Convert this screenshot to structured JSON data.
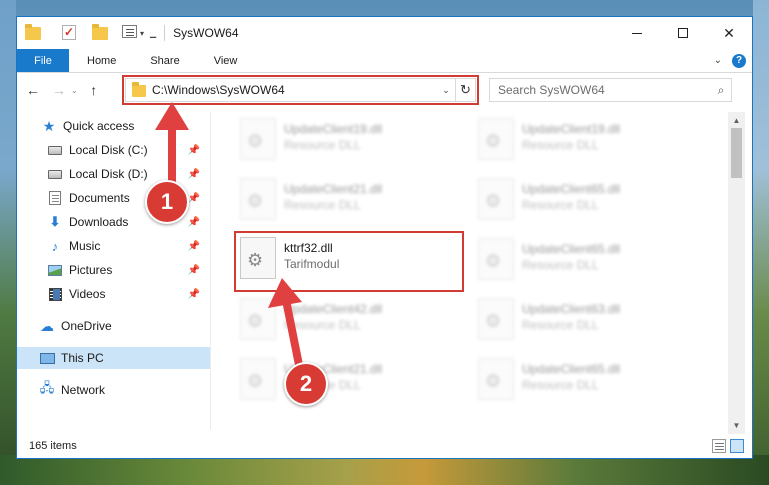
{
  "window": {
    "title": "SysWOW64"
  },
  "ribbon": {
    "tabs": [
      "File",
      "Home",
      "Share",
      "View"
    ]
  },
  "nav": {
    "address": "C:\\Windows\\SysWOW64",
    "search_placeholder": "Search SysWOW64"
  },
  "sidebar": {
    "items": [
      {
        "label": "Quick access",
        "icon": "star-icon"
      },
      {
        "label": "Local Disk (C:)",
        "icon": "drive-icon",
        "pinned": true
      },
      {
        "label": "Local Disk (D:)",
        "icon": "drive-icon",
        "pinned": true
      },
      {
        "label": "Documents",
        "icon": "document-icon",
        "pinned": true
      },
      {
        "label": "Downloads",
        "icon": "download-icon",
        "pinned": true
      },
      {
        "label": "Music",
        "icon": "music-icon",
        "pinned": true
      },
      {
        "label": "Pictures",
        "icon": "picture-icon",
        "pinned": true
      },
      {
        "label": "Videos",
        "icon": "video-icon",
        "pinned": true
      },
      {
        "label": "OneDrive",
        "icon": "cloud-icon"
      },
      {
        "label": "This PC",
        "icon": "computer-icon",
        "selected": true
      },
      {
        "label": "Network",
        "icon": "network-icon"
      }
    ]
  },
  "files": [
    {
      "name": "UpdateClient19.dll",
      "type": "Resource DLL",
      "blurred": true
    },
    {
      "name": "UpdateClient19.dll",
      "type": "Resource DLL",
      "blurred": true
    },
    {
      "name": "UpdateClient21.dll",
      "type": "Resource DLL",
      "blurred": true
    },
    {
      "name": "UpdateClient65.dll",
      "type": "Resource DLL",
      "blurred": true
    },
    {
      "name": "kttrf32.dll",
      "type": "Tarifmodul",
      "blurred": false,
      "highlighted": true
    },
    {
      "name": "UpdateClient65.dll",
      "type": "Resource DLL",
      "blurred": true
    },
    {
      "name": "UpdateClient42.dll",
      "type": "Resource DLL",
      "blurred": true
    },
    {
      "name": "UpdateClient63.dll",
      "type": "Resource DLL",
      "blurred": true
    },
    {
      "name": "UpdateClient21.dll",
      "type": "Resource DLL",
      "blurred": true
    },
    {
      "name": "UpdateClient65.dll",
      "type": "Resource DLL",
      "blurred": true
    }
  ],
  "status": {
    "count": "165 items"
  },
  "annotations": {
    "step1": "1",
    "step2": "2"
  },
  "colors": {
    "accent": "#1979ca",
    "highlight_red": "#d23a34",
    "selected_bg": "#cce4f7"
  }
}
